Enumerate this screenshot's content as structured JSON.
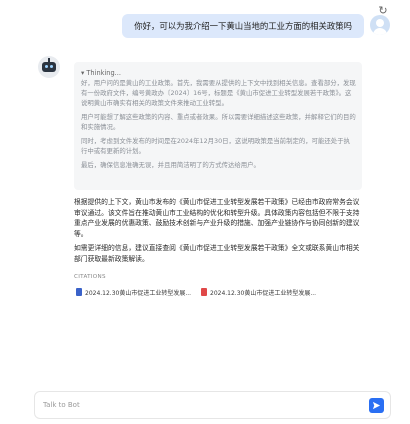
{
  "header": {
    "refresh_icon": "refresh-icon"
  },
  "user_message": {
    "text": "你好，可以为我介绍一下黄山当地的工业方面的相关政策吗",
    "avatar_icon": "user-avatar-icon"
  },
  "bot": {
    "avatar_icon": "robot-avatar-icon",
    "thinking": {
      "title": "▾ Thinking...",
      "paragraphs": [
        "好，用户问的是黄山的工业政策。首先，我需要从提供的上下文中找到相关信息。查看部分，发现有一份政府文件，编号黄政办〔2024〕16号，标题是《黄山市促进工业转型发展若干政策》。这说明黄山市确实有相关的政策文件来推动工业转型。",
        "用户可能想了解这些政策的内容、重点或者效果。所以需要详细描述这些政策，并解释它们的目的和实施情况。",
        "同时，考虑到文件发布的时间是在2024年12月30日，这说明政策是当前制定的，可能还处于执行中或有更新的计划。",
        "最后，确保信息准确无误，并且用简洁明了的方式传达给用户。"
      ]
    },
    "answer": {
      "paragraphs": [
        "根据提供的上下文，黄山市发布的《黄山市促进工业转型发展若干政策》已经由市政府常务会议审议通过。该文件旨在推动黄山市工业结构的优化和转型升级。具体政策内容包括但不限于支持重点产业发展的优惠政策、鼓励技术创新与产业升级的措施、加强产业链协作与协同创新的建议等。",
        "如需更详细的信息，建议直接查阅《黄山市促进工业转型发展若干政策》全文或联系黄山市相关部门获取最新政策解读。"
      ]
    },
    "citations": {
      "label": "CITATIONS",
      "items": [
        {
          "title": "2024.12.30黄山市促进工业转型发展...",
          "icon": "document-icon",
          "icon_color": "#3a62c9"
        },
        {
          "title": "2024.12.30黄山市促进工业转型发展...",
          "icon": "pdf-icon",
          "icon_color": "#e04848"
        }
      ]
    }
  },
  "input": {
    "placeholder": "Talk to Bot",
    "value": "",
    "send_icon": "send-icon",
    "send_color": "#2a6ff3"
  }
}
